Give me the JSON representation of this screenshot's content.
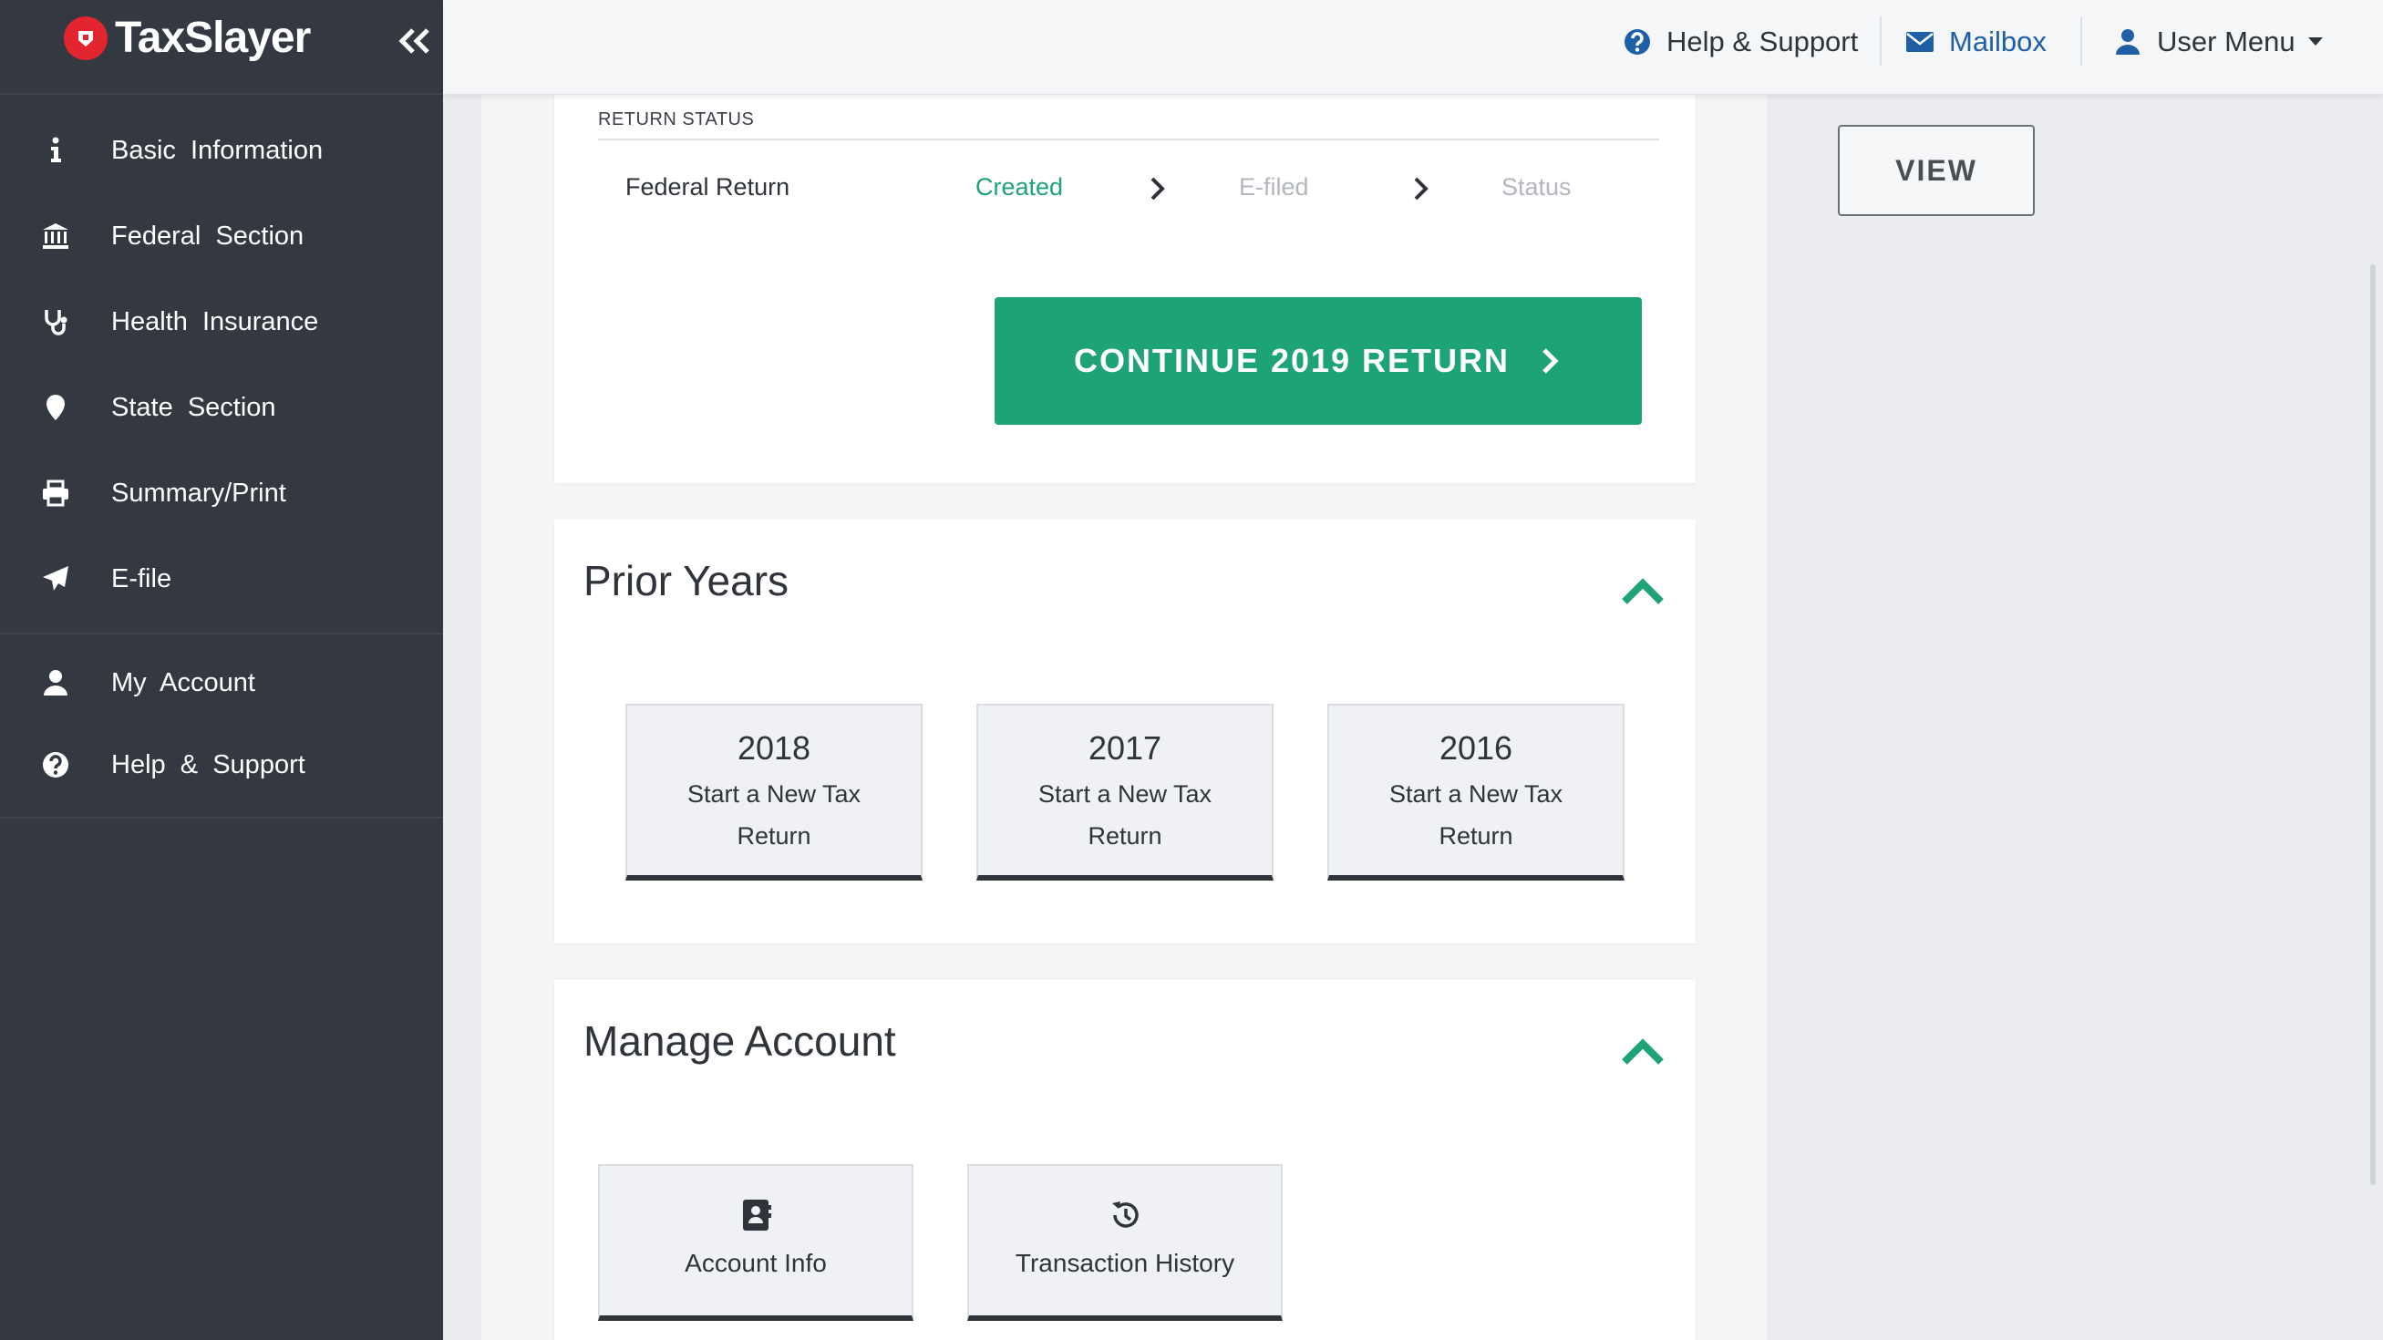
{
  "app": {
    "logo_text": "TaxSlayer"
  },
  "sidebar": {
    "items": [
      {
        "label": "Basic  Information",
        "icon": "info-icon"
      },
      {
        "label": "Federal  Section",
        "icon": "bank-icon"
      },
      {
        "label": "Health  Insurance",
        "icon": "stethoscope-icon"
      },
      {
        "label": "State  Section",
        "icon": "map-pin-icon"
      },
      {
        "label": "Summary/Print",
        "icon": "printer-icon"
      },
      {
        "label": "E-file",
        "icon": "paper-plane-icon"
      }
    ],
    "secondary_items": [
      {
        "label": "My  Account",
        "icon": "user-icon"
      },
      {
        "label": "Help  &  Support",
        "icon": "question-circle-icon"
      }
    ]
  },
  "topbar": {
    "help_label": "Help & Support",
    "mailbox_label": "Mailbox",
    "user_menu_label": "User Menu"
  },
  "return_status": {
    "label": "RETURN STATUS",
    "row_label": "Federal Return",
    "steps": [
      "Created",
      "E-filed",
      "Status"
    ],
    "continue_label": "CONTINUE 2019 RETURN"
  },
  "prior_years": {
    "title": "Prior Years",
    "tiles": [
      {
        "year": "2018",
        "label": "Start a New Tax Return"
      },
      {
        "year": "2017",
        "label": "Start a New Tax Return"
      },
      {
        "year": "2016",
        "label": "Start a New Tax Return"
      }
    ]
  },
  "manage_account": {
    "title": "Manage Account",
    "tiles": [
      {
        "label": "Account Info",
        "icon": "address-book-icon"
      },
      {
        "label": "Transaction History",
        "icon": "history-icon"
      }
    ]
  },
  "right_panel": {
    "view_label": "VIEW"
  },
  "colors": {
    "accent_green": "#1ea374",
    "sidebar_bg": "#333841",
    "link_blue": "#1f5fa8",
    "brand_red": "#e3252f"
  }
}
